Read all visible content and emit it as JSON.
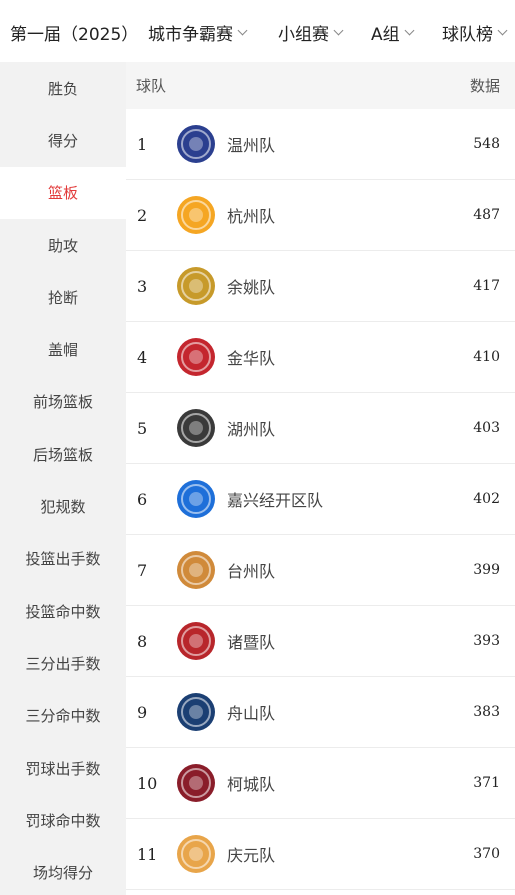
{
  "header": {
    "season": "第一届（2025）",
    "filters": [
      {
        "label": "城市争霸赛"
      },
      {
        "label": "小组赛"
      },
      {
        "label": "A组"
      },
      {
        "label": "球队榜"
      }
    ]
  },
  "sidebar": {
    "items": [
      {
        "label": "胜负"
      },
      {
        "label": "得分"
      },
      {
        "label": "篮板",
        "active": true
      },
      {
        "label": "助攻"
      },
      {
        "label": "抢断"
      },
      {
        "label": "盖帽"
      },
      {
        "label": "前场篮板"
      },
      {
        "label": "后场篮板"
      },
      {
        "label": "犯规数"
      },
      {
        "label": "投篮出手数"
      },
      {
        "label": "投篮命中数"
      },
      {
        "label": "三分出手数"
      },
      {
        "label": "三分命中数"
      },
      {
        "label": "罚球出手数"
      },
      {
        "label": "罚球命中数"
      },
      {
        "label": "场均得分"
      }
    ]
  },
  "table": {
    "col_team": "球队",
    "col_data": "数据",
    "rows": [
      {
        "rank": "1",
        "team": "温州队",
        "value": "548",
        "logo": "wenzhou-logo",
        "color": "#2b3f8f"
      },
      {
        "rank": "2",
        "team": "杭州队",
        "value": "487",
        "logo": "hangzhou-logo",
        "color": "#f5a623"
      },
      {
        "rank": "3",
        "team": "余姚队",
        "value": "417",
        "logo": "yuyao-logo",
        "color": "#c79a2a"
      },
      {
        "rank": "4",
        "team": "金华队",
        "value": "410",
        "logo": "jinhua-logo",
        "color": "#c4262e"
      },
      {
        "rank": "5",
        "team": "湖州队",
        "value": "403",
        "logo": "huzhou-logo",
        "color": "#3a3a3a"
      },
      {
        "rank": "6",
        "team": "嘉兴经开区队",
        "value": "402",
        "logo": "jiaxing-logo",
        "color": "#1e6fd9"
      },
      {
        "rank": "7",
        "team": "台州队",
        "value": "399",
        "logo": "taizhou-logo",
        "color": "#d08a3a"
      },
      {
        "rank": "8",
        "team": "诸暨队",
        "value": "393",
        "logo": "zhuji-logo",
        "color": "#b8262b"
      },
      {
        "rank": "9",
        "team": "舟山队",
        "value": "383",
        "logo": "zhoushan-logo",
        "color": "#1b3f73"
      },
      {
        "rank": "10",
        "team": "柯城队",
        "value": "371",
        "logo": "kecheng-logo",
        "color": "#8a1d2a"
      },
      {
        "rank": "11",
        "team": "庆元队",
        "value": "370",
        "logo": "qingyuan-logo",
        "color": "#e8a54a"
      }
    ]
  }
}
